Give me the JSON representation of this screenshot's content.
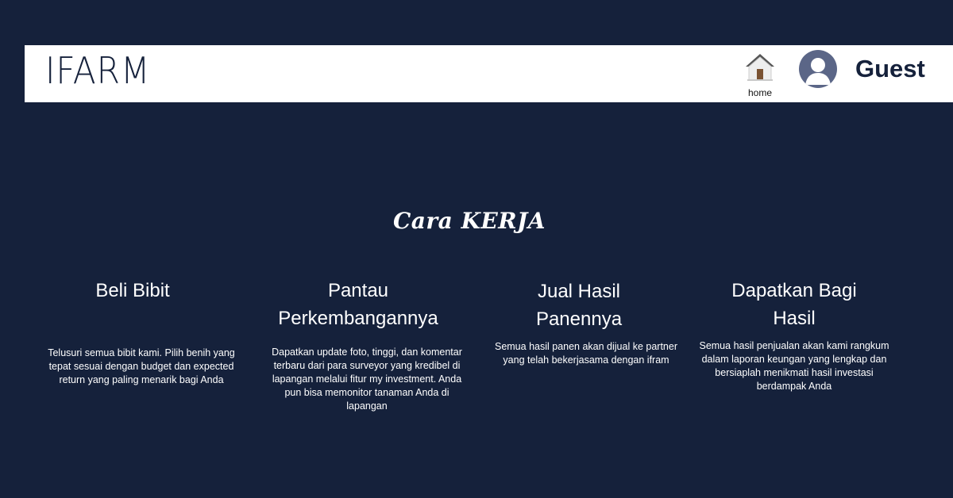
{
  "header": {
    "logo": "IFARM",
    "home_label": "home",
    "user_name": "Guest"
  },
  "icons": {
    "home": "home-icon",
    "avatar": "user-avatar-icon"
  },
  "colors": {
    "background": "#15213b",
    "header_bg": "#ffffff",
    "avatar": "#5b6687",
    "text": "#ffffff"
  },
  "section": {
    "title": "Cara KERJA"
  },
  "steps": [
    {
      "title_lines": [
        "Beli Bibit"
      ],
      "description": "Telusuri semua bibit kami. Pilih benih yang tepat sesuai dengan budget dan expected return yang paling menarik bagi Anda"
    },
    {
      "title_lines": [
        "Pantau",
        "Perkembangannya"
      ],
      "description": "Dapatkan update foto, tinggi, dan komentar terbaru dari para surveyor yang kredibel di lapangan melalui fitur my investment. Anda pun bisa memonitor tanaman Anda di lapangan"
    },
    {
      "title_lines": [
        "Jual Hasil",
        "Panennya"
      ],
      "description": "Semua hasil panen akan dijual ke partner yang telah bekerjasama dengan ifram"
    },
    {
      "title_lines": [
        "Dapatkan Bagi",
        "Hasil"
      ],
      "description": "Semua hasil penjualan akan kami rangkum dalam laporan keungan yang lengkap dan bersiaplah menikmati hasil investasi berdampak Anda"
    }
  ]
}
